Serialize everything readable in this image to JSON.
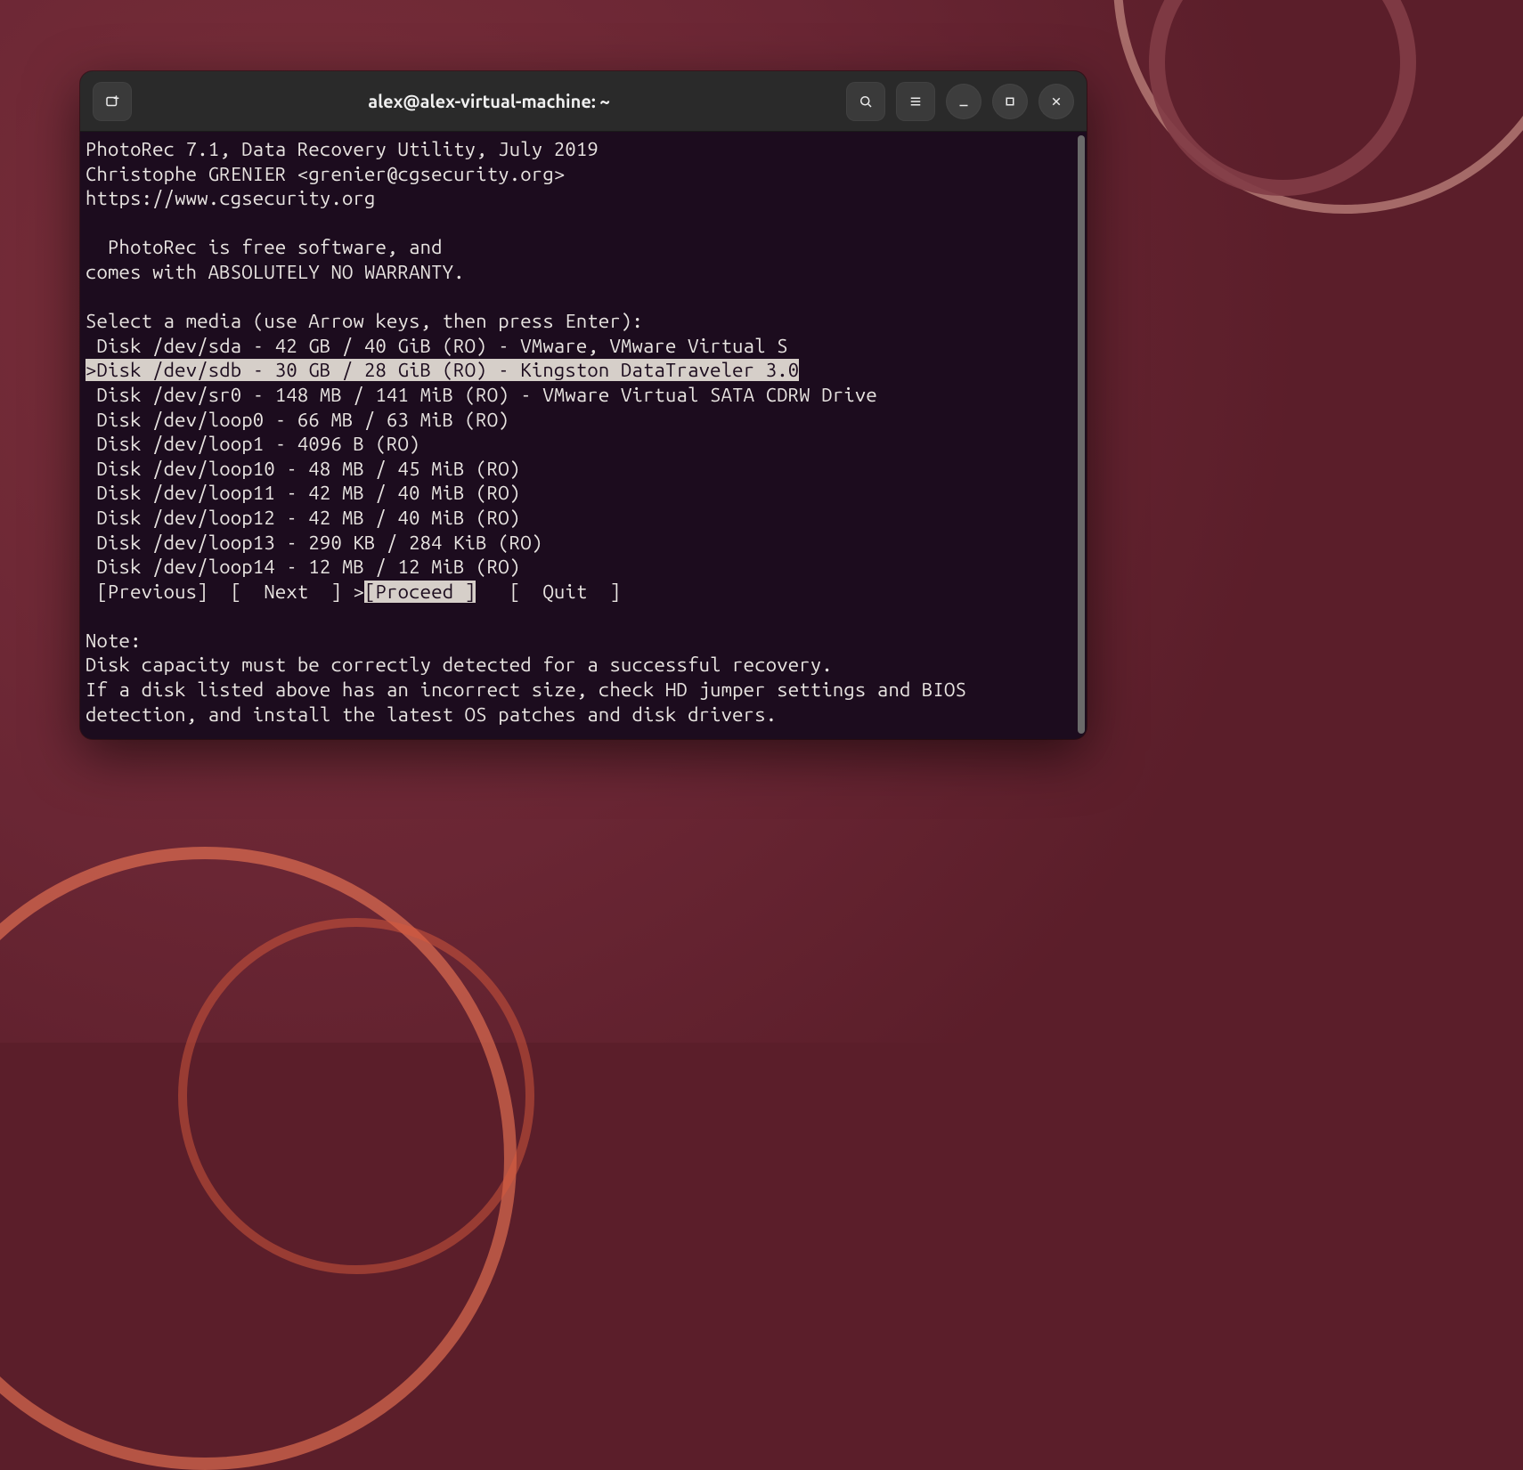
{
  "window": {
    "title": "alex@alex-virtual-machine: ~"
  },
  "header": {
    "l1": "PhotoRec 7.1, Data Recovery Utility, July 2019",
    "l2": "Christophe GRENIER <grenier@cgsecurity.org>",
    "l3": "https://www.cgsecurity.org"
  },
  "warranty": {
    "l1": "  PhotoRec is free software, and",
    "l2": "comes with ABSOLUTELY NO WARRANTY."
  },
  "prompt": "Select a media (use Arrow keys, then press Enter):",
  "disks": {
    "d0": " Disk /dev/sda - 42 GB / 40 GiB (RO) - VMware, VMware Virtual S",
    "d1_prefix": ">",
    "d1_text": "Disk /dev/sdb - 30 GB / 28 GiB (RO) - Kingston DataTraveler 3.0",
    "d2": " Disk /dev/sr0 - 148 MB / 141 MiB (RO) - VMware Virtual SATA CDRW Drive",
    "d3": " Disk /dev/loop0 - 66 MB / 63 MiB (RO)",
    "d4": " Disk /dev/loop1 - 4096 B (RO)",
    "d5": " Disk /dev/loop10 - 48 MB / 45 MiB (RO)",
    "d6": " Disk /dev/loop11 - 42 MB / 40 MiB (RO)",
    "d7": " Disk /dev/loop12 - 42 MB / 40 MiB (RO)",
    "d8": " Disk /dev/loop13 - 290 KB / 284 KiB (RO)",
    "d9": " Disk /dev/loop14 - 12 MB / 12 MiB (RO)"
  },
  "menu": {
    "prev": " [Previous] ",
    "next_open": " [  ",
    "next_label": "Next",
    "next_close": "  ] ",
    "proceed_mark": ">",
    "proceed_open": "[",
    "proceed_label": "Proceed ",
    "proceed_close": "]",
    "gap": "  ",
    "quit_open": " [  ",
    "quit_label": "Quit",
    "quit_close": "  ]"
  },
  "note": {
    "title": "Note:",
    "l1": "Disk capacity must be correctly detected for a successful recovery.",
    "l2": "If a disk listed above has an incorrect size, check HD jumper settings and BIOS",
    "l3": "detection, and install the latest OS patches and disk drivers."
  }
}
